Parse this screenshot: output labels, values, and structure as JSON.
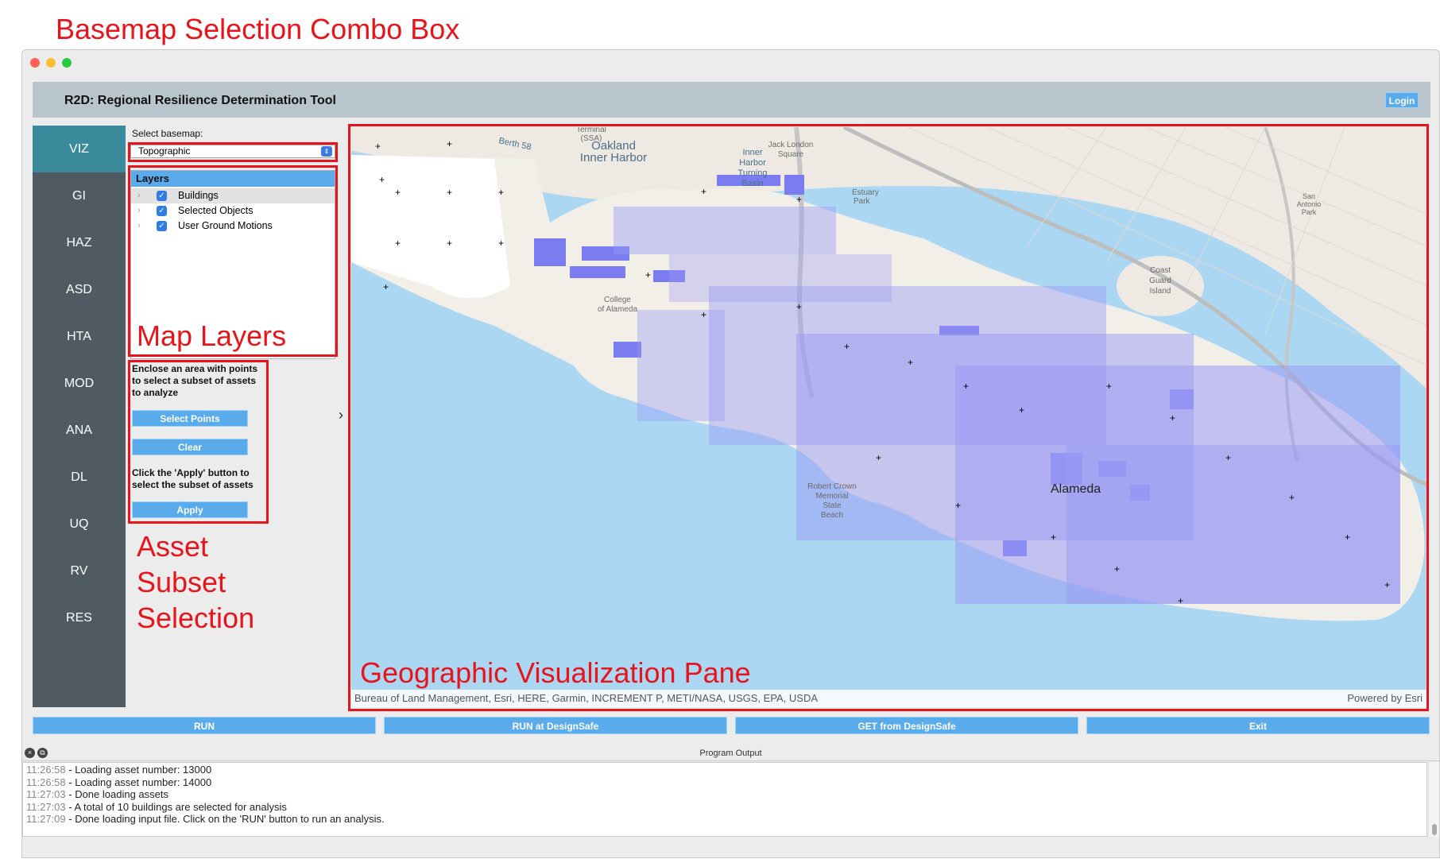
{
  "annotations": {
    "basemap_combo": "Basemap Selection Combo Box",
    "map_layers": "Map Layers",
    "asset_line1": "Asset",
    "asset_line2": "Subset",
    "asset_line3": "Selection",
    "geo_pane": "Geographic Visualization Pane"
  },
  "header": {
    "title": "R2D: Regional Resilience Determination Tool",
    "login_label": "Login"
  },
  "sidebar": {
    "items": [
      {
        "label": "VIZ",
        "active": true
      },
      {
        "label": "GI"
      },
      {
        "label": "HAZ"
      },
      {
        "label": "ASD"
      },
      {
        "label": "HTA"
      },
      {
        "label": "MOD"
      },
      {
        "label": "ANA"
      },
      {
        "label": "DL"
      },
      {
        "label": "UQ"
      },
      {
        "label": "RV"
      },
      {
        "label": "RES"
      }
    ]
  },
  "basemap": {
    "label": "Select basemap:",
    "value": "Topographic"
  },
  "layers": {
    "header": "Layers",
    "items": [
      {
        "label": "Buildings",
        "checked": true
      },
      {
        "label": "Selected Objects",
        "checked": true
      },
      {
        "label": "User Ground Motions",
        "checked": true
      }
    ]
  },
  "subset": {
    "instructions": "Enclose an area with points to select a subset of assets to analyze",
    "select_points": "Select Points",
    "clear": "Clear",
    "apply_instructions": "Click the 'Apply' button to select the subset of assets",
    "apply": "Apply"
  },
  "map": {
    "labels": {
      "oakland_inner_harbor": "Oakland Inner Harbor",
      "jack_london": "Jack London Square",
      "inner_harbor_basin": "Inner Harbor Turning Basin",
      "alameda": "Alameda",
      "estuary_park": "Estuary Park",
      "coast_guard": "Coast Guard Island",
      "robert_crown": "Robert Crown Memorial State Beach",
      "college_alameda": "College of Alameda",
      "san_antonio_park": "San Antonio Park",
      "berth": "Berth 58",
      "terminal": "Terminal (SSA)"
    },
    "attribution": "Bureau of Land Management, Esri, HERE, Garmin, INCREMENT P, METI/NASA, USGS, EPA, USDA",
    "powered_by": "Powered by Esri"
  },
  "toolbar": {
    "run": "RUN",
    "run_designsafe": "RUN at DesignSafe",
    "get_designsafe": "GET from DesignSafe",
    "exit": "Exit"
  },
  "output": {
    "title": "Program Output",
    "lines": [
      {
        "time": "11:26:58",
        "text": " - Loading asset number: 13000"
      },
      {
        "time": "11:26:58",
        "text": " - Loading asset number: 14000"
      },
      {
        "time": "11:27:03",
        "text": " - Done loading assets"
      },
      {
        "time": "11:27:03",
        "text": " - A total of 10 buildings are selected for analysis"
      },
      {
        "time": "11:27:09",
        "text": " - Done loading input file. Click on the 'RUN' button to run an analysis."
      }
    ]
  },
  "colors": {
    "accent": "#5aabec",
    "annotation": "#e8141b",
    "sidebar": "#4f5a63",
    "sidebar_active": "#3b8a9c",
    "water": "#abd7f3",
    "building": "#7b7cf0"
  }
}
